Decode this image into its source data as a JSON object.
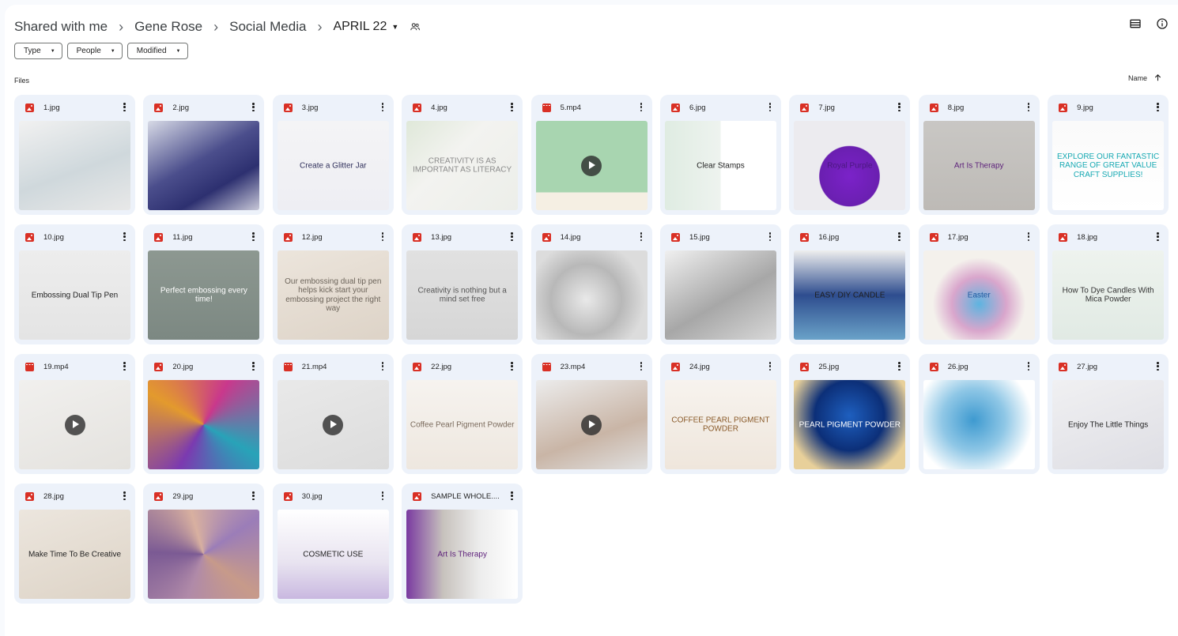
{
  "breadcrumb": {
    "root": "Shared with me",
    "items": [
      "Gene Rose",
      "Social Media"
    ],
    "current": "APRIL 22",
    "separator": "›"
  },
  "header_icons": [
    "list-view-icon",
    "info-icon"
  ],
  "filters": [
    {
      "label": "Type"
    },
    {
      "label": "People"
    },
    {
      "label": "Modified"
    }
  ],
  "section_label": "Files",
  "sort": {
    "label": "Name",
    "direction": "ascending"
  },
  "files": [
    {
      "name": "1.jpg",
      "type": "image",
      "thumb_bg": "linear-gradient(160deg,#f1f1f1 0%,#cfd8dc 55%,#e8e8e8 100%)",
      "thumb_fg": "#333",
      "thumb_text": ""
    },
    {
      "name": "2.jpg",
      "type": "image",
      "thumb_bg": "linear-gradient(150deg,#d7dae6 0%,#4b4e8c 45%,#2d3070 70%,#c8c8d8 100%)",
      "thumb_fg": "#fff",
      "thumb_text": ""
    },
    {
      "name": "3.jpg",
      "type": "image",
      "thumb_bg": "linear-gradient(180deg,#f4f4f6 0%,#eeeef3 100%)",
      "thumb_fg": "#2f2f5a",
      "thumb_text": "Create a Glitter Jar"
    },
    {
      "name": "4.jpg",
      "type": "image",
      "thumb_bg": "linear-gradient(135deg,#dfe8d9 0%,#f3f3f0 40%,#eceee9 100%)",
      "thumb_fg": "#8a8a8a",
      "thumb_text": "CREATIVITY IS AS IMPORTANT AS LITERACY"
    },
    {
      "name": "5.mp4",
      "type": "video",
      "thumb_bg": "linear-gradient(180deg,#a8d5b0 0%,#a8d5b0 80%,#f5efe3 80%)",
      "thumb_fg": "#333",
      "thumb_text": ""
    },
    {
      "name": "6.jpg",
      "type": "image",
      "thumb_bg": "linear-gradient(90deg,#dfece2 0%,#eef3ef 50%,#ffffff 50%)",
      "thumb_fg": "#222",
      "thumb_text": "Clear Stamps"
    },
    {
      "name": "7.jpg",
      "type": "image",
      "thumb_bg": "radial-gradient(circle at 50% 62%,#7b22c9 0%,#6a1fb0 38%,#ecebef 39%)",
      "thumb_fg": "#4b1880",
      "thumb_text": "Royal Purple"
    },
    {
      "name": "8.jpg",
      "type": "image",
      "thumb_bg": "linear-gradient(180deg,#c9c7c4 0%,#bdbab6 100%)",
      "thumb_fg": "#5c1f7a",
      "thumb_text": "Art Is Therapy"
    },
    {
      "name": "9.jpg",
      "type": "image",
      "thumb_bg": "linear-gradient(180deg,#fafafa 0%,#ffffff 100%)",
      "thumb_fg": "#17a9b3",
      "thumb_text": "EXPLORE OUR FANTASTIC RANGE OF GREAT VALUE CRAFT SUPPLIES!"
    },
    {
      "name": "10.jpg",
      "type": "image",
      "thumb_bg": "linear-gradient(180deg,#ededed 0%,#e4e4e4 100%)",
      "thumb_fg": "#222",
      "thumb_text": "Embossing Dual Tip Pen"
    },
    {
      "name": "11.jpg",
      "type": "image",
      "thumb_bg": "linear-gradient(180deg,#8d9891 0%,#7c8882 100%)",
      "thumb_fg": "#ffffff",
      "thumb_text": "Perfect embossing every time!"
    },
    {
      "name": "12.jpg",
      "type": "image",
      "thumb_bg": "linear-gradient(160deg,#ece5dc 0%,#ddd3c7 100%)",
      "thumb_fg": "#6d655b",
      "thumb_text": "Our embossing dual tip pen helps kick start your embossing project the right way"
    },
    {
      "name": "13.jpg",
      "type": "image",
      "thumb_bg": "linear-gradient(180deg,#e1e1e1 0%,#d6d6d6 100%)",
      "thumb_fg": "#555",
      "thumb_text": "Creativity is nothing but a mind set free"
    },
    {
      "name": "14.jpg",
      "type": "image",
      "thumb_bg": "radial-gradient(circle at 45% 55%,#e9e9e9 0%,#b8b8b8 45%,#dcdcdc 75%)",
      "thumb_fg": "#333",
      "thumb_text": ""
    },
    {
      "name": "15.jpg",
      "type": "image",
      "thumb_bg": "linear-gradient(150deg,#f0f0f0 0%,#a7a7a7 55%,#d8d8d8 100%)",
      "thumb_fg": "#333",
      "thumb_text": ""
    },
    {
      "name": "16.jpg",
      "type": "image",
      "thumb_bg": "linear-gradient(180deg,#eeeeee 0%,#2e4d8f 50%,#6aa2c8 100%)",
      "thumb_fg": "#1f1f1f",
      "thumb_text": "EASY DIY CANDLE"
    },
    {
      "name": "17.jpg",
      "type": "image",
      "thumb_bg": "radial-gradient(circle at 50% 60%,#5db4e0 0%,#d9a6cc 35%,#f4f1ec 60%)",
      "thumb_fg": "#1f5aa0",
      "thumb_text": "Easter"
    },
    {
      "name": "18.jpg",
      "type": "image",
      "thumb_bg": "linear-gradient(180deg,#eef3ee 0%,#e1eae4 100%)",
      "thumb_fg": "#333",
      "thumb_text": "How To Dye Candles With Mica Powder"
    },
    {
      "name": "19.mp4",
      "type": "video",
      "thumb_bg": "linear-gradient(160deg,#f1f0ee 0%,#e4e2de 100%)",
      "thumb_fg": "#333",
      "thumb_text": ""
    },
    {
      "name": "20.jpg",
      "type": "image",
      "thumb_bg": "conic-gradient(from 30deg,#c9388c,#28a3b8,#7b3ab0,#e39a2d,#c9388c)",
      "thumb_fg": "#fff",
      "thumb_text": ""
    },
    {
      "name": "21.mp4",
      "type": "video",
      "thumb_bg": "linear-gradient(160deg,#e9e9e9 0%,#dcdcdc 100%)",
      "thumb_fg": "#333",
      "thumb_text": ""
    },
    {
      "name": "22.jpg",
      "type": "image",
      "thumb_bg": "linear-gradient(180deg,#f6f3ef 0%,#eee7df 100%)",
      "thumb_fg": "#7a6a5c",
      "thumb_text": "Coffee Pearl Pigment Powder"
    },
    {
      "name": "23.mp4",
      "type": "video",
      "thumb_bg": "linear-gradient(160deg,#ececec 0%,#c9b5a6 60%,#e0e0e0 100%)",
      "thumb_fg": "#333",
      "thumb_text": ""
    },
    {
      "name": "24.jpg",
      "type": "image",
      "thumb_bg": "linear-gradient(180deg,#f7f3ee 0%,#efe6dc 100%)",
      "thumb_fg": "#8a5a2a",
      "thumb_text": "COFFEE PEARL PIGMENT POWDER"
    },
    {
      "name": "25.jpg",
      "type": "image",
      "thumb_bg": "radial-gradient(circle at 50% 40%,#1e5fbf 0%,#0c2f78 45%,#e8d09a 80%)",
      "thumb_fg": "#ffffff",
      "thumb_text": "PEARL PIGMENT POWDER"
    },
    {
      "name": "26.jpg",
      "type": "image",
      "thumb_bg": "radial-gradient(circle at 45% 45%,#3e9ad0 0%,#8fc7e6 40%,#ffffff 75%)",
      "thumb_fg": "#333",
      "thumb_text": ""
    },
    {
      "name": "27.jpg",
      "type": "image",
      "thumb_bg": "linear-gradient(160deg,#f0f0f2 0%,#dedee4 100%)",
      "thumb_fg": "#1f1f1f",
      "thumb_text": "Enjoy The Little Things"
    },
    {
      "name": "28.jpg",
      "type": "image",
      "thumb_bg": "linear-gradient(160deg,#ece6de 0%,#ddd3c6 100%)",
      "thumb_fg": "#1f1f1f",
      "thumb_text": "Make Time To Be Creative"
    },
    {
      "name": "29.jpg",
      "type": "image",
      "thumb_bg": "conic-gradient(from 200deg,#b08aa8,#7b5a94,#d8b0a0,#9b7db8,#c79a8a,#b08aa8)",
      "thumb_fg": "#fff",
      "thumb_text": ""
    },
    {
      "name": "30.jpg",
      "type": "image",
      "thumb_bg": "linear-gradient(180deg,#ffffff 0%,#e8e3f0 60%,#c9b8e0 100%)",
      "thumb_fg": "#1f1f1f",
      "thumb_text": "COSMETIC USE"
    },
    {
      "name": "SAMPLE WHOLE....",
      "type": "image",
      "thumb_bg": "linear-gradient(90deg,#7a3aa0 0%,#c7c2bd 33%,#ededed 66%,#ffffff 100%)",
      "thumb_fg": "#5c1f7a",
      "thumb_text": "Art Is Therapy"
    }
  ]
}
